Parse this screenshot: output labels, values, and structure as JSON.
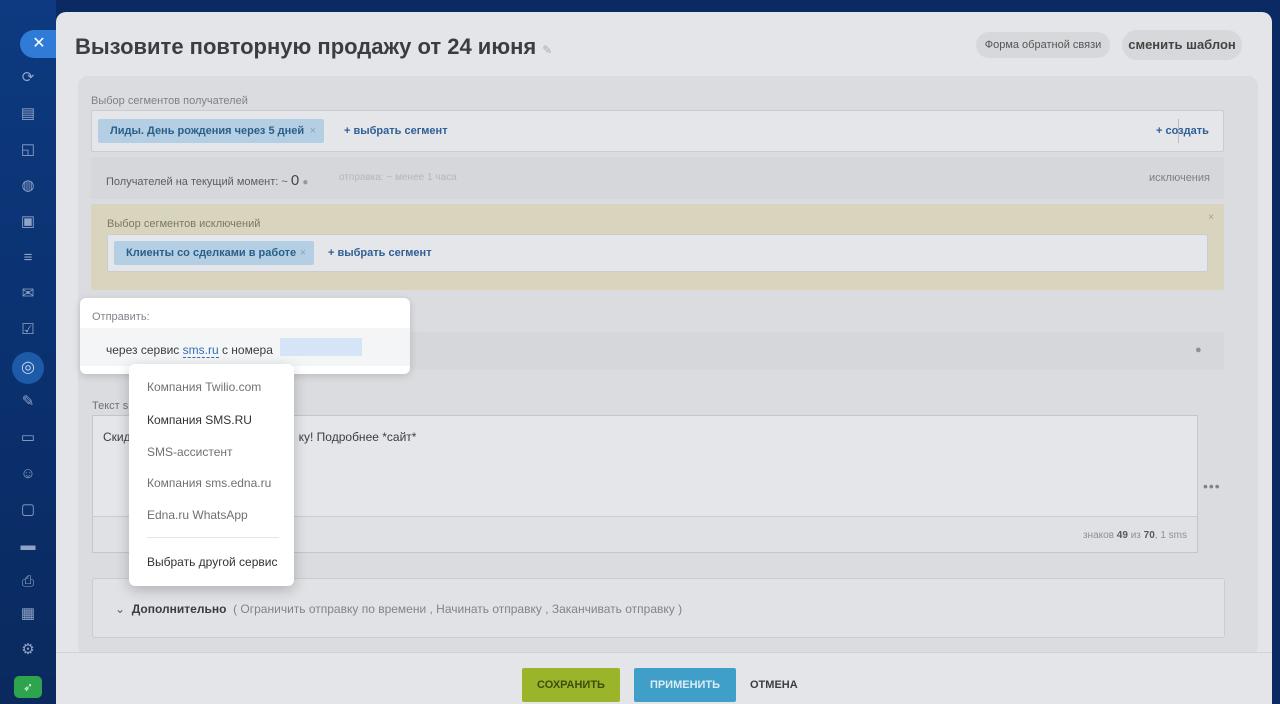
{
  "sidebar": {
    "close_icon": "✕",
    "icons": [
      "refresh-icon",
      "document-icon",
      "chat-icon",
      "globe-icon",
      "clipboard-icon",
      "filter-icon",
      "mail-icon",
      "checkbox-icon",
      "marketing-icon",
      "pen-icon",
      "monitor-icon",
      "users-icon",
      "file-icon",
      "card-icon",
      "printer-icon",
      "calendar-icon",
      "settings-icon",
      "rocket-icon"
    ]
  },
  "header": {
    "title": "Вызовите повторную продажу от 24 июня",
    "feedback_button": "Форма обратной связи",
    "template_button": "сменить шаблон"
  },
  "segments": {
    "label": "Выбор сегментов получателей",
    "chip": "Лиды. День рождения через 5 дней",
    "add_link": "+ выбрать сегмент",
    "create_link": "+ создать"
  },
  "recipients": {
    "text": "Получателей на текущий момент: ~",
    "count": "0",
    "send_time": "отправка: ~ менее 1 часа",
    "exclusions_link": "исключения"
  },
  "exclusions": {
    "label": "Выбор сегментов исключений",
    "chip": "Клиенты со сделками в работе",
    "add_link": "+ выбрать сегмент"
  },
  "send": {
    "label": "Отправить:",
    "prefix": "через сервис",
    "service": "sms.ru",
    "suffix": "с номера"
  },
  "sms_text": {
    "label_visible": "Текст sr",
    "prefix_visible": "Скид",
    "suffix_visible": "ку! Подробнее *сайт*",
    "counter_prefix": "знаков",
    "counter_value": "49",
    "counter_mid": "из",
    "counter_max": "70",
    "counter_suffix": ", 1 sms"
  },
  "extra": {
    "title": "Дополнительно",
    "options": "( Ограничить отправку по времени ,  Начинать отправку ,  Заканчивать отправку )"
  },
  "dropdown": {
    "items": [
      "Компания Twilio.com",
      "Компания SMS.RU",
      "SMS-ассистент",
      "Компания sms.edna.ru",
      "Edna.ru WhatsApp"
    ],
    "other": "Выбрать другой сервис"
  },
  "footer": {
    "save": "СОХРАНИТЬ",
    "apply": "ПРИМЕНИТЬ",
    "cancel": "ОТМЕНА"
  }
}
